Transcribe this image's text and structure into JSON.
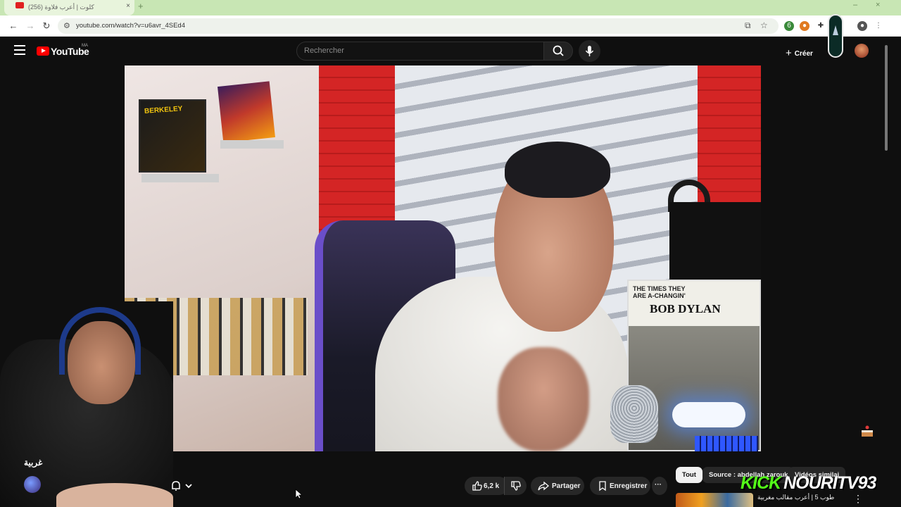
{
  "browser": {
    "tab_title": "كلوت | أعرب فلاوة (256)",
    "url": "youtube.com/watch?v=u6avr_4SEd4",
    "extension_badge": "6"
  },
  "header": {
    "logo_text": "YouTube",
    "region": "MA",
    "search_placeholder": "Rechercher",
    "create_label": "Créer"
  },
  "video": {
    "album_title_small": "THE TIMES THEY ARE A-CHANGIN'",
    "album_artist": "BOB DYLAN",
    "poster_text": "BERKELEY"
  },
  "below_video": {
    "channel_name": "غربية",
    "like_count": "6,2 k",
    "share_label": "Partager",
    "save_label": "Enregistrer",
    "more_label": "···"
  },
  "chips": [
    {
      "label": "Tout",
      "active": true
    },
    {
      "label": "Source : abdellah zarouk",
      "active": false
    },
    {
      "label": "Vidéos similai",
      "active": false
    }
  ],
  "recommendation": {
    "title": "طوب 5 | أعرب مقالب مغربية"
  },
  "watermark": {
    "platform": "KICK",
    "channel": "NOURITV93"
  },
  "colors": {
    "accent": "#ff0000",
    "kick_green": "#53fc18",
    "background": "#0f0f0f"
  }
}
